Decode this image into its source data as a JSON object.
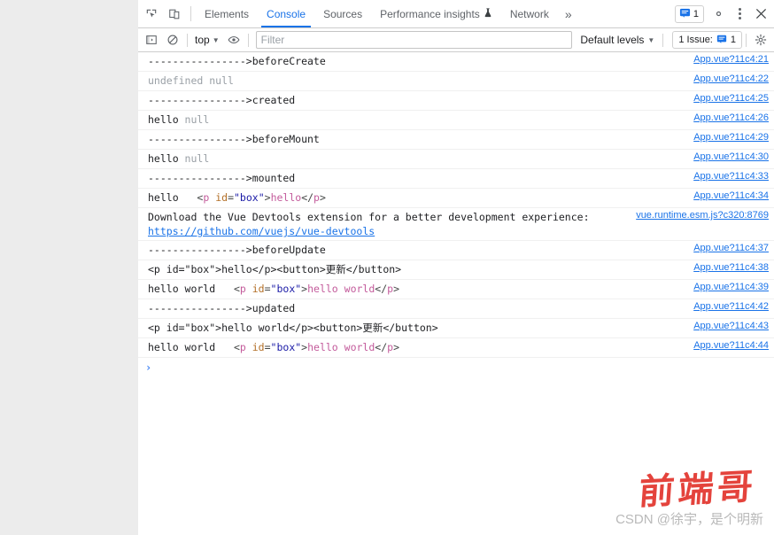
{
  "window": {
    "app": "Chrome DevTools"
  },
  "tabbar": {
    "inspect_icon": "inspect-element-icon",
    "device_icon": "device-toolbar-icon",
    "tabs": [
      {
        "label": "Elements",
        "active": false
      },
      {
        "label": "Console",
        "active": true
      },
      {
        "label": "Sources",
        "active": false
      },
      {
        "label": "Performance insights",
        "active": false,
        "icon": "flask-icon"
      },
      {
        "label": "Network",
        "active": false
      }
    ],
    "more_label": "»",
    "issues_count": "1",
    "settings_icon": "gear-icon",
    "menu_icon": "kebab-menu-icon",
    "close_icon": "close-icon"
  },
  "filterbar": {
    "sidebar_icon": "console-sidebar-icon",
    "clear_icon": "clear-console-icon",
    "context": "top",
    "eye_icon": "live-expression-icon",
    "filter_placeholder": "Filter",
    "filter_value": "",
    "levels_label": "Default levels",
    "issue_label": "1 Issue:",
    "issue_count": "1",
    "settings_icon": "console-settings-icon"
  },
  "console": {
    "prompt": "›",
    "rows": [
      {
        "kind": "text",
        "text": "---------------->beforeCreate",
        "source": "App.vue?11c4:21"
      },
      {
        "kind": "dim",
        "text": "undefined null",
        "source": "App.vue?11c4:22"
      },
      {
        "kind": "text",
        "text": "---------------->created",
        "source": "App.vue?11c4:25"
      },
      {
        "kind": "mixed",
        "plain": "hello ",
        "dimtext": "null",
        "source": "App.vue?11c4:26"
      },
      {
        "kind": "text",
        "text": "---------------->beforeMount",
        "source": "App.vue?11c4:29"
      },
      {
        "kind": "mixed",
        "plain": "hello ",
        "dimtext": "null",
        "source": "App.vue?11c4:30"
      },
      {
        "kind": "text",
        "text": "---------------->mounted",
        "source": "App.vue?11c4:33"
      },
      {
        "kind": "html",
        "prefix": "hello",
        "tag": "p",
        "attr": "id",
        "value": "\"box\"",
        "inner": "hello",
        "source": "App.vue?11c4:34"
      },
      {
        "kind": "devtools",
        "text": "Download the Vue Devtools extension for a better development experience:",
        "link": "https://github.com/vuejs/vue-devtools",
        "source": "vue.runtime.esm.js?c320:8769"
      },
      {
        "kind": "text",
        "text": "---------------->beforeUpdate",
        "source": "App.vue?11c4:37"
      },
      {
        "kind": "text",
        "text": "<p id=\"box\">hello</p><button>更新</button>",
        "source": "App.vue?11c4:38"
      },
      {
        "kind": "html",
        "prefix": "hello world",
        "tag": "p",
        "attr": "id",
        "value": "\"box\"",
        "inner": "hello world",
        "source": "App.vue?11c4:39"
      },
      {
        "kind": "text",
        "text": "---------------->updated",
        "source": "App.vue?11c4:42"
      },
      {
        "kind": "text",
        "text": "<p id=\"box\">hello world</p><button>更新</button>",
        "source": "App.vue?11c4:43"
      },
      {
        "kind": "html",
        "prefix": "hello world",
        "tag": "p",
        "attr": "id",
        "value": "\"box\"",
        "inner": "hello world",
        "source": "App.vue?11c4:44"
      }
    ]
  },
  "watermark": {
    "calligraphy": "前端哥",
    "csdn": "CSDN @徐宇，是个明新"
  },
  "colors": {
    "accent": "#1a73e8",
    "tag": "#c35b9b",
    "attr_name": "#b36f27",
    "attr_value": "#1a1aa6",
    "dim": "#9aa0a6",
    "watermark_red": "#e2342c"
  }
}
